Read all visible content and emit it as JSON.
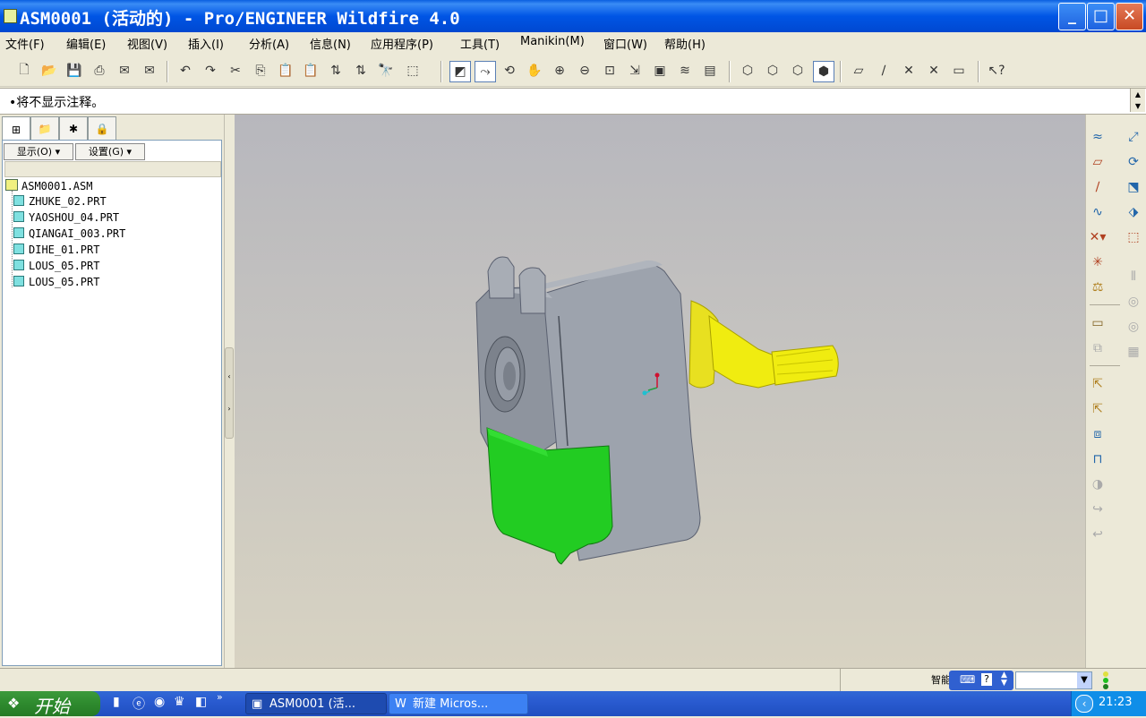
{
  "window": {
    "title": "ASM0001 (活动的) - Pro/ENGINEER Wildfire 4.0",
    "controls": {
      "minimize": "_",
      "maximize": "□",
      "close": "✕"
    }
  },
  "menu": [
    "文件(F)",
    "编辑(E)",
    "视图(V)",
    "插入(I)",
    "分析(A)",
    "信息(N)",
    "应用程序(P)",
    "工具(T)",
    "Manikin(M)",
    "窗口(W)",
    "帮助(H)"
  ],
  "message": "•将不显示注释。",
  "model_tree": {
    "tabs": [
      "model-tree",
      "layers",
      "favorites",
      "settings"
    ],
    "show_label": "显示(O)",
    "settings_label": "设置(G)",
    "root": "ASM0001.ASM",
    "items": [
      "ZHUKE_02.PRT",
      "YAOSHOU_04.PRT",
      "QIANGAI_003.PRT",
      "DIHE_01.PRT",
      "LOUS_05.PRT",
      "LOUS_05.PRT"
    ]
  },
  "status": {
    "filter_label": "智能",
    "filter_value": ""
  },
  "taskbar": {
    "start": "开始",
    "tasks": [
      "ASM0001 (活...",
      "新建 Micros..."
    ],
    "clock": "21:23"
  }
}
